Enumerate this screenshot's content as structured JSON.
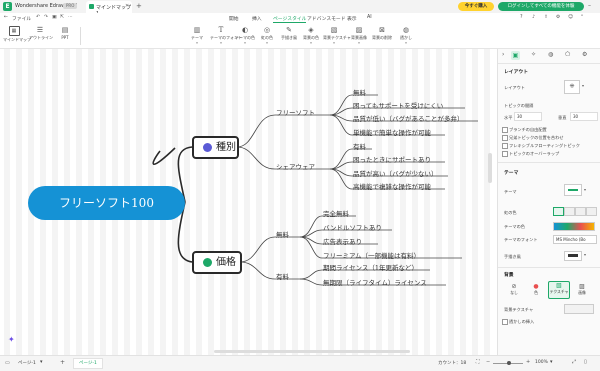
{
  "window": {
    "app_name": "Wondershare EdrawMind",
    "badge": "PRO",
    "tab_label": "マインドマップ1",
    "buy_label": "今すぐ購入",
    "login_label": "ログインしてすべての機能を体験"
  },
  "menu": {
    "left": [
      "ファイル"
    ],
    "items": [
      "開始",
      "挿入",
      "ページスタイル",
      "アドバンスモード",
      "表示",
      "AI"
    ],
    "active_index": 2
  },
  "ribbon": {
    "left_tools": [
      {
        "label": "マインドマップ",
        "icon": "mindmap-icon"
      },
      {
        "label": "アウトライン",
        "icon": "outline-icon"
      },
      {
        "label": "PPT",
        "icon": "ppt-icon"
      }
    ],
    "tools": [
      {
        "label": "テーマ",
        "icon": "theme-icon"
      },
      {
        "label": "テーマのフォント",
        "icon": "font-icon"
      },
      {
        "label": "テーマの色",
        "icon": "color-icon"
      },
      {
        "label": "虹の色",
        "icon": "rainbow-icon"
      },
      {
        "label": "手描き風",
        "icon": "handdrawn-icon"
      },
      {
        "label": "背景の色",
        "icon": "bg-color-icon"
      },
      {
        "label": "背景テクスチャ",
        "icon": "texture-icon"
      },
      {
        "label": "背景画像",
        "icon": "bg-image-icon"
      },
      {
        "label": "背景の削除",
        "icon": "bg-delete-icon"
      },
      {
        "label": "透かし",
        "icon": "watermark-icon"
      }
    ]
  },
  "mindmap": {
    "root": "フリーソフト100",
    "branches": [
      {
        "label": "種別",
        "icon_color": "#5b5bd6",
        "groups": [
          {
            "label": "フリーソフト",
            "items": [
              "無料",
              "困ってもサポートを受けにくい",
              "品質が低い（バグがあることが多弁）",
              "単機能で簡単な操作が可能"
            ]
          },
          {
            "label": "シェアウェア",
            "items": [
              "有料",
              "困ったときにサポートあり",
              "品質が高い（バグが少ない）",
              "高機能で複雑な操作が可能"
            ]
          }
        ]
      },
      {
        "label": "価格",
        "icon_color": "#1ea868",
        "groups": [
          {
            "label": "無料",
            "items": [
              "完全無料",
              "バンドルソフトあり",
              "広告表示あり",
              "フリーミアム（一部機能は有料）"
            ]
          },
          {
            "label": "有料",
            "items": [
              "期間ライセンス（1年更新など）",
              "無期限（ライフタイム）ライセンス"
            ]
          }
        ]
      }
    ]
  },
  "panel": {
    "tabs": [
      "layout-tab-icon",
      "style-tab-icon",
      "mark-tab-icon",
      "clipart-tab-icon",
      "settings-tab-icon"
    ],
    "layout_title": "レイアウト",
    "layout_label": "レイアウト",
    "topic_spacing": "トピックの間隔",
    "horizontal_label": "水平",
    "horizontal_value": "30",
    "vertical_label": "垂直",
    "vertical_value": "30",
    "options": [
      "ブランチの自由配置",
      "兄弟トピックの位置を合わせ",
      "フレキシブルフローティングトピック",
      "トピックのオーバーラップ"
    ],
    "theme_title": "テーマ",
    "theme_label": "テーマ",
    "rainbow_label": "虹の色",
    "theme_color_label": "テーマの色",
    "theme_font_label": "テーマのフォント",
    "theme_font_value": "MS Mincho (Bo",
    "handdrawn_label": "手描き風",
    "bg_title": "背景",
    "bg_options": [
      "なし",
      "色",
      "テクスチャ",
      "画像"
    ],
    "bg_texture_label": "背景テクスチャ",
    "watermark_label": "透かしの挿入",
    "colors": {
      "accent": "#1ea868",
      "root": "#1592d5"
    }
  },
  "status": {
    "page_selector": "ページ-1",
    "page_tab": "ページ-1",
    "count_label": "カウント：18",
    "zoom": "100%"
  }
}
